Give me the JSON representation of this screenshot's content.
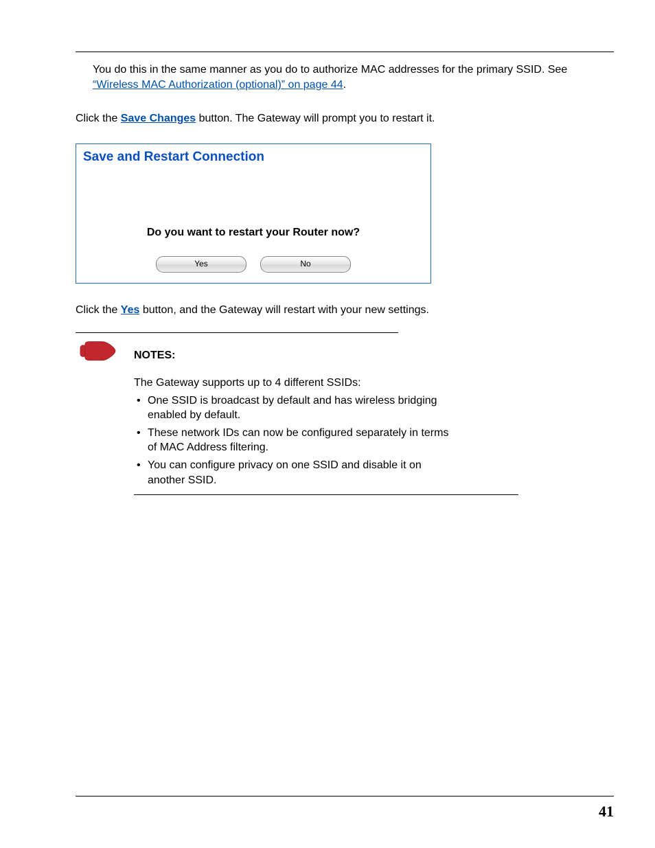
{
  "intro": {
    "sentence1": "You do this in the same manner as you do to authorize MAC addresses for the primary SSID. See ",
    "link_text": "“Wireless MAC Authorization (optional)” on page 44",
    "period": "."
  },
  "save_instruction": {
    "pre": "Click the ",
    "bold_link": "Save Changes",
    "post": " button. The Gateway will prompt you to restart it."
  },
  "dialog": {
    "title": "Save and Restart Connection",
    "question": "Do you want to restart your Router now?",
    "yes_label": "Yes",
    "no_label": "No"
  },
  "yes_instruction": {
    "pre": "Click the ",
    "bold_link": "Yes",
    "post": " button, and the Gateway will restart with your new settings."
  },
  "notes": {
    "heading": "NOTES:",
    "intro": "The Gateway supports up to 4 different SSIDs:",
    "items": [
      "One SSID is broadcast by default and has wireless bridging enabled by default.",
      "These network IDs can now be configured separately in terms of MAC Address filtering.",
      "You can configure privacy on one SSID and disable it on another SSID."
    ]
  },
  "page_number": "41"
}
